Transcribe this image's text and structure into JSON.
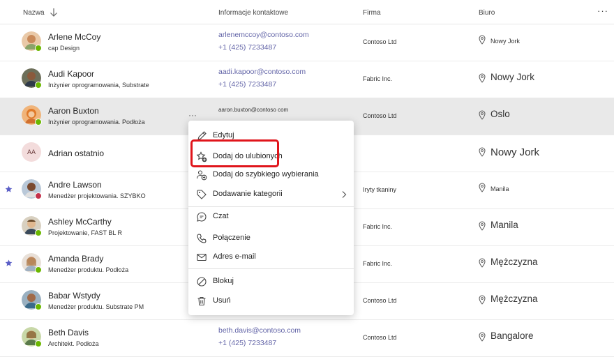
{
  "header": {
    "name": "Nazwa",
    "contact": "Informacje kontaktowe",
    "company": "Firma",
    "office": "Biuro",
    "more": "···"
  },
  "rows": [
    {
      "name": "Arlene McCoy",
      "title": "cap Design",
      "email": "arlenemccoy@contoso.com",
      "phone": "+1 (425) 7233487",
      "company": "Contoso Ltd",
      "office": "Nowy Jork"
    },
    {
      "name": "Audi Kapoor",
      "title": "Inżynier oprogramowania, Substrate",
      "email": "aadi.kapoor@contoso.com",
      "phone": "+1 (425) 7233487",
      "company": "Fabric Inc.",
      "office": "Nowy Jork"
    },
    {
      "name": "Aaron Buxton",
      "title": "Inżynier oprogramowania. Podłoża",
      "email": "aaron.buxton@contoso com",
      "phone": "",
      "company": "Contoso Ltd",
      "office": "Oslo",
      "more": "···"
    },
    {
      "name": "Adrian ostatnio",
      "initials": "AA",
      "title": "",
      "email": "",
      "phone": "",
      "company": "",
      "office": "Nowy Jork"
    },
    {
      "name": "Andre Lawson",
      "title": "Menedżer projektowania. SZYBKO",
      "email": "",
      "phone": "",
      "company": "Iryty tkaniny",
      "office": "Manila"
    },
    {
      "name": "Ashley McCarthy",
      "title": "Projektowanie, FAST BL R",
      "email": "",
      "phone": "",
      "company": "Fabric Inc.",
      "office": "Manila"
    },
    {
      "name": "Amanda Brady",
      "title": "Menedżer produktu. Podłoża",
      "email": "",
      "phone": "",
      "company": "Fabric Inc.",
      "office": "Mężczyzna"
    },
    {
      "name": "Babar Wstydy",
      "title": "Menedżer produktu. Substrate PM",
      "email": "",
      "phone": "",
      "company": "Contoso Ltd",
      "office": "Mężczyzna"
    },
    {
      "name": "Beth Davis",
      "title": "Architekt. Podłoża",
      "email": "beth.davis@contoso.com",
      "phone": "+1 (425) 7233487",
      "company": "Contoso Ltd",
      "office": "Bangalore"
    }
  ],
  "menu": {
    "edit": "Edytuj",
    "favorite": "Dodaj do ulubionych",
    "speed_dial": "Dodaj do szybkiego wybierania",
    "category": "Dodawanie kategorii",
    "chat": "Czat",
    "call": "Połączenie",
    "email": "Adres e-mail",
    "block": "Blokuj",
    "delete": "Usuń"
  },
  "colors": {
    "link": "#6264a7",
    "favorite_star": "#5b5fc7",
    "highlight": "#e0151b",
    "presence_available": "#6bb700",
    "presence_busy": "#c4314b"
  }
}
